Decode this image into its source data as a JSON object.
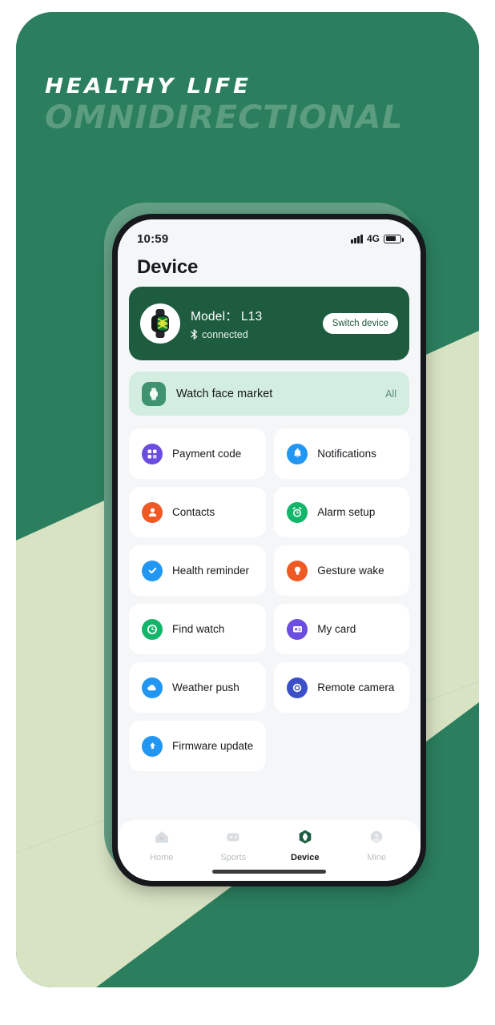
{
  "promo": {
    "headline_1": "HEALTHY LIFE",
    "headline_2": "OMNIDIRECTIONAL",
    "brand_green": "#2b7f5e",
    "pale_green": "#d8e3c3",
    "deep_green": "#1d5c3f"
  },
  "statusbar": {
    "time": "10:59",
    "network": "4G",
    "signal_icon": "signal-bars-icon",
    "battery_icon": "battery-icon"
  },
  "header": {
    "title": "Device"
  },
  "device_card": {
    "model_label": "Model：",
    "model_value": "L13",
    "bluetooth_glyph": "ᛗ",
    "connection_status": "connected",
    "switch_button": "Switch device",
    "avatar_icon": "smartwatch-icon"
  },
  "watch_face_market": {
    "icon": "watch-icon",
    "label": "Watch face market",
    "action": "All"
  },
  "grid": {
    "tiles": [
      {
        "label": "Payment code",
        "icon": "qr-grid-icon",
        "color": "#6b4de0"
      },
      {
        "label": "Notifications",
        "icon": "bell-icon",
        "color": "#2196f3"
      },
      {
        "label": "Contacts",
        "icon": "person-icon",
        "color": "#ef5a24"
      },
      {
        "label": "Alarm setup",
        "icon": "alarm-clock-icon",
        "color": "#13b56a"
      },
      {
        "label": "Health reminder",
        "icon": "check-circle-icon",
        "color": "#2196f3"
      },
      {
        "label": "Gesture wake",
        "icon": "bulb-icon",
        "color": "#ef5a24"
      },
      {
        "label": "Find watch",
        "icon": "clock-icon",
        "color": "#13b56a"
      },
      {
        "label": "My card",
        "icon": "id-card-icon",
        "color": "#6b4de0"
      },
      {
        "label": "Weather push",
        "icon": "cloud-icon",
        "color": "#2196f3"
      },
      {
        "label": "Remote camera",
        "icon": "camera-icon",
        "color": "#3b50c8"
      },
      {
        "label": "Firmware update",
        "icon": "upload-arrow-icon",
        "color": "#2196f3"
      }
    ]
  },
  "tabbar": {
    "items": [
      {
        "label": "Home",
        "icon": "home-icon",
        "active": false
      },
      {
        "label": "Sports",
        "icon": "gamepad-icon",
        "active": false
      },
      {
        "label": "Device",
        "icon": "hexagon-watch-icon",
        "active": true
      },
      {
        "label": "Mine",
        "icon": "person-circle-icon",
        "active": false
      }
    ]
  }
}
